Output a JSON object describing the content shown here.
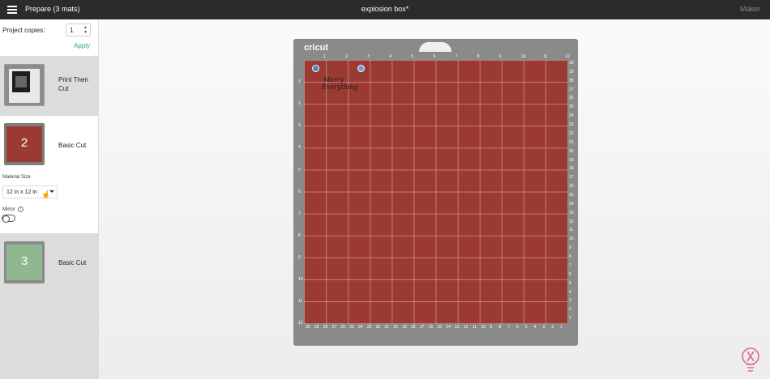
{
  "topbar": {
    "menu_icon": "hamburger-menu-icon",
    "title": "Prepare (3 mats)",
    "document": "explosion box*",
    "make": "Maker"
  },
  "sidebar": {
    "copies_label": "Project copies:",
    "copies_value": "1",
    "apply_label": "Apply",
    "mats": [
      {
        "number": "",
        "label": "Print Then Cut"
      },
      {
        "number": "2",
        "label": "Basic Cut",
        "color": "#9a3a33"
      },
      {
        "number": "3",
        "label": "Basic Cut",
        "color": "#8fb891"
      }
    ],
    "material_size_label": "Material Size",
    "material_size_value": "12 in x 12 in",
    "mirror_label": "Mirror",
    "mirror_on": false
  },
  "mat_preview": {
    "logo": "cricut",
    "top_ruler": [
      "1",
      "2",
      "3",
      "4",
      "5",
      "6",
      "7",
      "8",
      "9",
      "10",
      "11",
      "12"
    ],
    "left_ruler": [
      "1",
      "2",
      "3",
      "4",
      "5",
      "6",
      "7",
      "8",
      "9",
      "10",
      "11",
      "12"
    ],
    "right_ruler": [
      "30",
      "29",
      "28",
      "27",
      "26",
      "25",
      "24",
      "23",
      "22",
      "21",
      "20",
      "19",
      "18",
      "17",
      "16",
      "15",
      "14",
      "13",
      "12",
      "11",
      "10",
      "9",
      "8",
      "7",
      "6",
      "5",
      "4",
      "3",
      "2",
      "1"
    ],
    "bottom_ruler": [
      "30",
      "29",
      "28",
      "27",
      "26",
      "25",
      "24",
      "23",
      "22",
      "21",
      "20",
      "19",
      "18",
      "17",
      "16",
      "15",
      "14",
      "13",
      "12",
      "11",
      "10",
      "9",
      "8",
      "7",
      "6",
      "5",
      "4",
      "3",
      "2",
      "1"
    ],
    "design_line1": "Merry",
    "design_line2": "Everything",
    "mat_color": "#9a3a33"
  },
  "accent_colors": {
    "apply": "#2fa861",
    "topbar": "#2b2b2d"
  }
}
